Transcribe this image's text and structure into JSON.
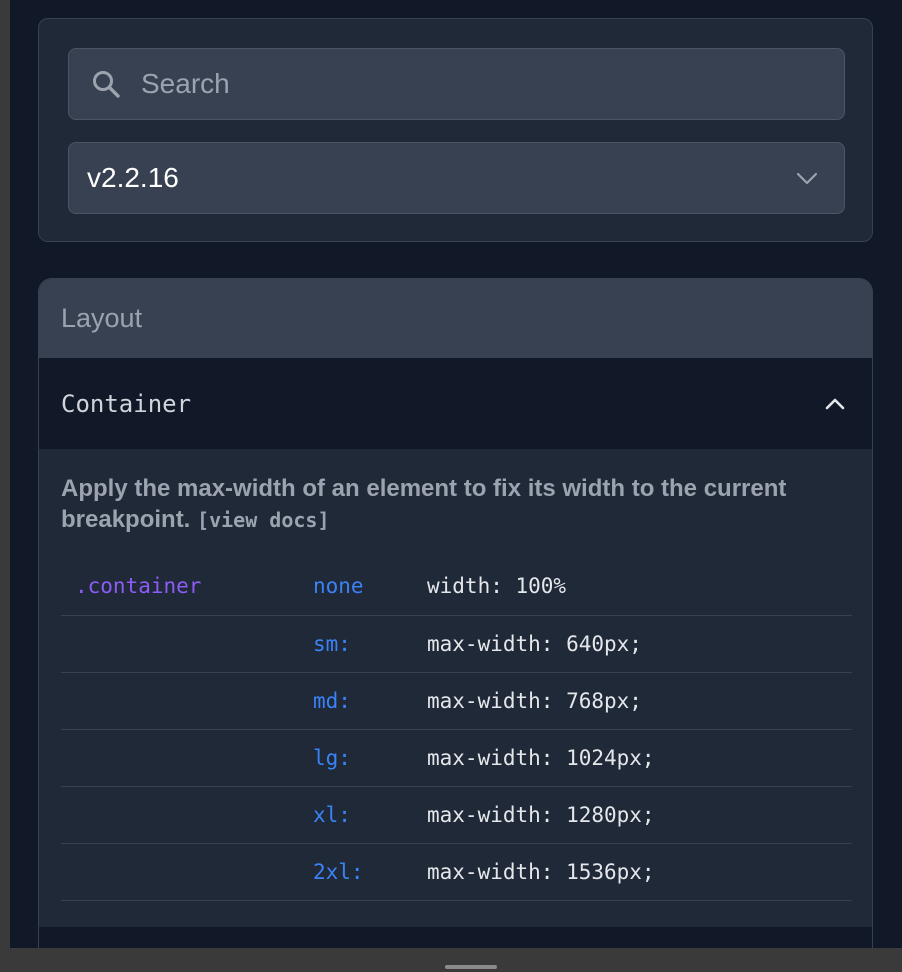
{
  "search": {
    "placeholder": "Search",
    "icon": "search-icon"
  },
  "version_select": {
    "selected": "v2.2.16",
    "icon": "chevron-down-icon"
  },
  "layout_section": {
    "title": "Layout",
    "accordion": {
      "title": "Container",
      "expanded": true,
      "icon": "chevron-up-icon",
      "description": "Apply the max-width of an element to fix its width to the current breakpoint.",
      "docs_link": "[view docs]",
      "rows": [
        {
          "class": ".container",
          "breakpoint": "none",
          "property": "width: 100%"
        },
        {
          "class": "",
          "breakpoint": "sm:",
          "property": "max-width: 640px;"
        },
        {
          "class": "",
          "breakpoint": "md:",
          "property": "max-width: 768px;"
        },
        {
          "class": "",
          "breakpoint": "lg:",
          "property": "max-width: 1024px;"
        },
        {
          "class": "",
          "breakpoint": "xl:",
          "property": "max-width: 1280px;"
        },
        {
          "class": "",
          "breakpoint": "2xl:",
          "property": "max-width: 1536px;"
        }
      ]
    }
  },
  "colors": {
    "background": "#111827",
    "card": "#1f2937",
    "input": "#374151",
    "class_name": "#8b5cf6",
    "breakpoint": "#3b82f6"
  }
}
